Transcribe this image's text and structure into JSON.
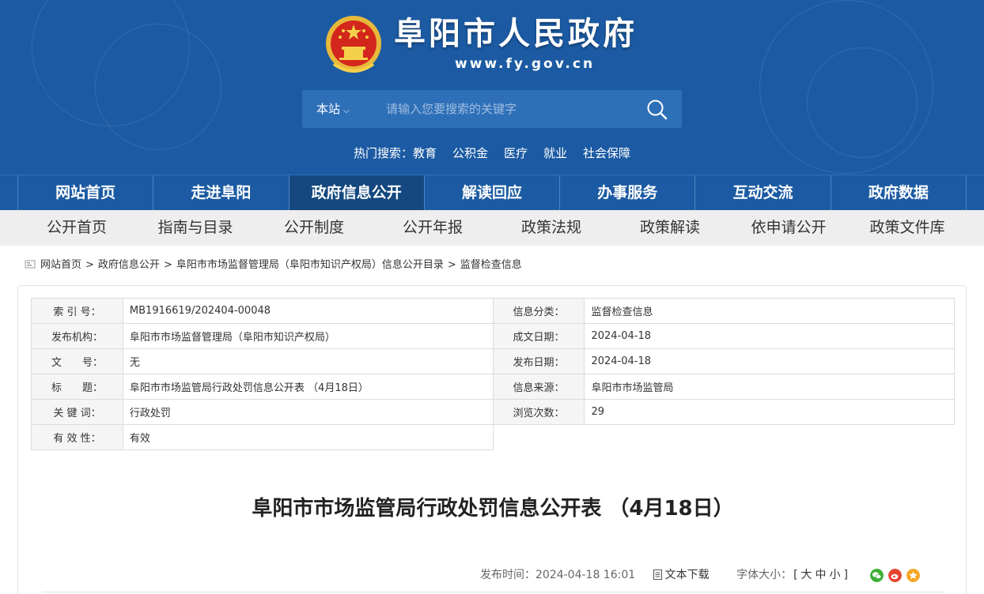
{
  "header": {
    "title": "阜阳市人民政府",
    "url": "www.fy.gov.cn",
    "search": {
      "scope": "本站",
      "placeholder": "请输入您要搜索的关键字"
    },
    "hot": {
      "label": "热门搜索：",
      "items": [
        "教育",
        "公积金",
        "医疗",
        "就业",
        "社会保障"
      ]
    }
  },
  "main_nav": {
    "items": [
      "网站首页",
      "走进阜阳",
      "政府信息公开",
      "解读回应",
      "办事服务",
      "互动交流",
      "政府数据"
    ],
    "active": "政府信息公开"
  },
  "sub_nav": {
    "items": [
      "公开首页",
      "指南与目录",
      "公开制度",
      "公开年报",
      "政策法规",
      "政策解读",
      "依申请公开",
      "政策文件库"
    ]
  },
  "breadcrumb": [
    "网站首页",
    "政府信息公开",
    "阜阳市市场监督管理局（阜阳市知识产权局）信息公开目录",
    "监督检查信息"
  ],
  "meta": {
    "left": [
      {
        "label": "索 引 号：",
        "value": "MB1916619/202404-00048"
      },
      {
        "label": "发布机构：",
        "value": "阜阳市市场监督管理局（阜阳市知识产权局）"
      },
      {
        "label": "文　　号：",
        "value": "无"
      },
      {
        "label": "标　　题：",
        "value": "阜阳市市场监管局行政处罚信息公开表 （4月18日）"
      },
      {
        "label": "关 键 词：",
        "value": "行政处罚"
      },
      {
        "label": "有 效 性：",
        "value": "有效"
      }
    ],
    "right": [
      {
        "label": "信息分类：",
        "value": "监督检查信息"
      },
      {
        "label": "成文日期：",
        "value": "2024-04-18"
      },
      {
        "label": "发布日期：",
        "value": "2024-04-18"
      },
      {
        "label": "信息来源：",
        "value": "阜阳市市场监管局"
      },
      {
        "label": "浏览次数：",
        "value": "29"
      }
    ]
  },
  "article": {
    "title": "阜阳市市场监管局行政处罚信息公开表 （4月18日）",
    "publish_time": "发布时间：2024-04-18 16:01",
    "download": "文本下载",
    "font_size_label": "字体大小：",
    "font_size_open": "[",
    "font_sizes": [
      "大",
      "中",
      "小"
    ],
    "font_size_close": "]"
  },
  "share_icons": [
    "wechat-icon",
    "weibo-icon",
    "favorite-icon"
  ],
  "colors": {
    "header_blue": "#1c5ba3",
    "nav_active": "#14487f",
    "subnav_bg": "#eeeeee",
    "wechat": "#3cb034",
    "weibo": "#e6432f",
    "favorite": "#f5a623"
  }
}
